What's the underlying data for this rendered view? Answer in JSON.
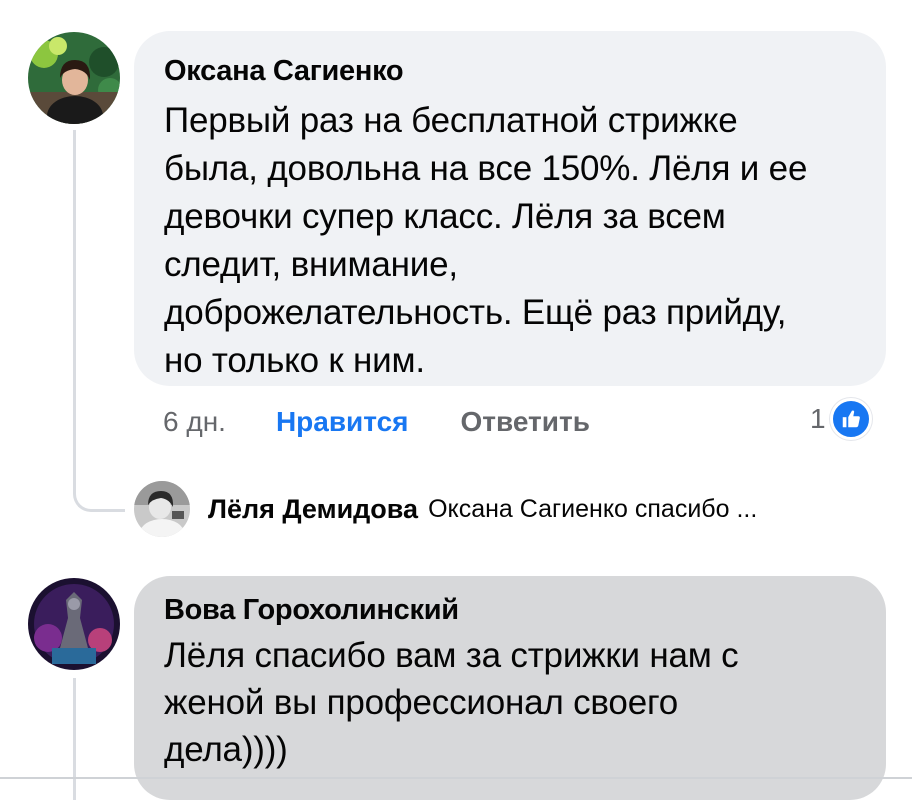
{
  "comments": [
    {
      "author": "Оксана Сагиенко",
      "text_lines": [
        "Первый раз на бесплатной стрижке",
        "была, довольна на все 150%. Лёля и ее",
        "девочки супер класс. Лёля за всем",
        "следит, внимание,",
        "доброжелательность. Ещё раз прийду,",
        "но только к ним."
      ],
      "time": "6 дн.",
      "like_label": "Нравится",
      "reply_label": "Ответить",
      "reaction_count": "1",
      "reaction_icon": "thumbs-up-icon"
    },
    {
      "author": "Вова Горохолинский",
      "text_lines": [
        "Лёля спасибо вам за стрижки нам с",
        "женой вы профессионал своего",
        "дела))))"
      ]
    }
  ],
  "reply_preview": {
    "author": "Лёля Демидова",
    "text": "Оксана Сагиенко спасибо ..."
  },
  "colors": {
    "bubble_light": "#f0f2f5",
    "bubble_gray": "#d7d8da",
    "link_blue": "#1877f2",
    "secondary_text": "#65676b",
    "primary_text": "#050505"
  }
}
